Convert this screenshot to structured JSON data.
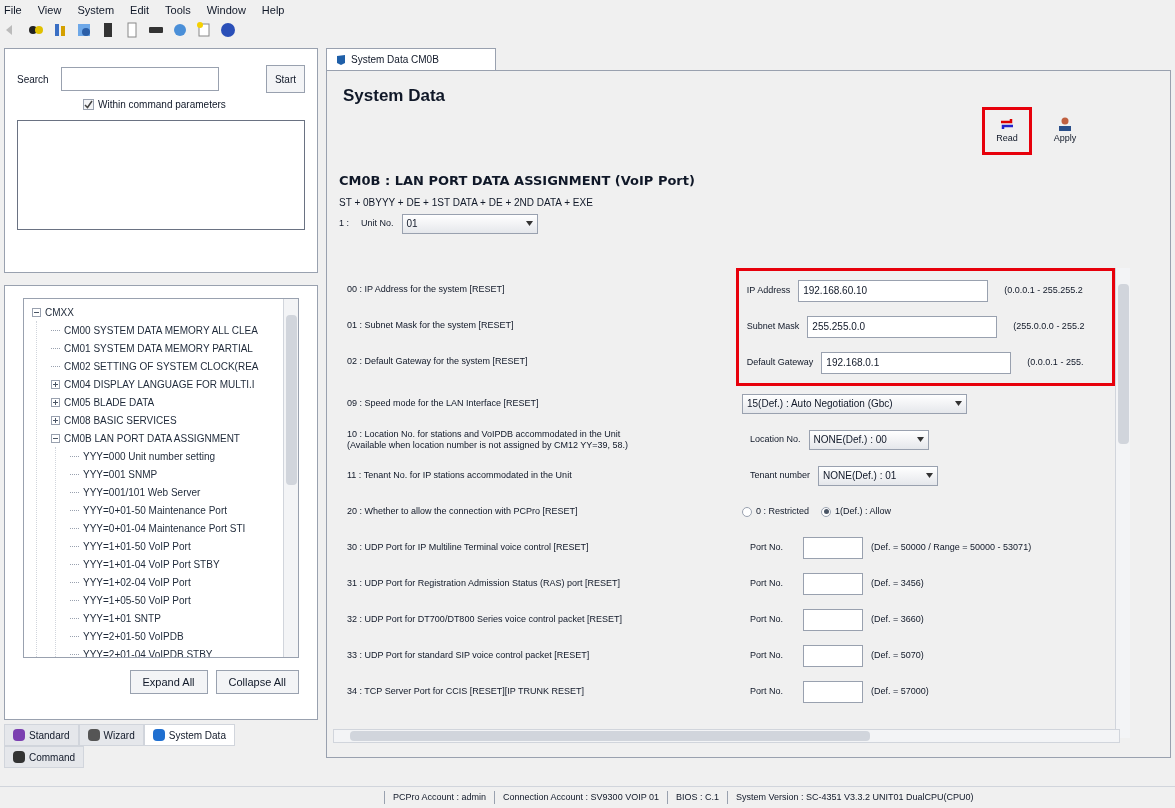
{
  "menu": [
    "File",
    "View",
    "System",
    "Edit",
    "Tools",
    "Window",
    "Help"
  ],
  "search": {
    "label": "Search",
    "button": "Start",
    "option": {
      "label": "Within command parameters",
      "checked": true
    }
  },
  "tree": [
    {
      "label": "CMXX",
      "expanded": true,
      "children": [
        {
          "label": "CM00 SYSTEM DATA MEMORY ALL CLEA"
        },
        {
          "label": "CM01 SYSTEM DATA MEMORY PARTIAL"
        },
        {
          "label": "CM02 SETTING OF SYSTEM CLOCK(REA"
        },
        {
          "label": "CM04 DISPLAY LANGUAGE FOR MULTI.I",
          "expanded": false
        },
        {
          "label": "CM05 BLADE DATA",
          "expanded": false
        },
        {
          "label": "CM08 BASIC SERVICES",
          "expanded": false
        },
        {
          "label": "CM0B LAN PORT DATA ASSIGNMENT",
          "expanded": true,
          "children": [
            {
              "label": "YYY=000 Unit number setting"
            },
            {
              "label": "YYY=001 SNMP"
            },
            {
              "label": "YYY=001/101 Web Server"
            },
            {
              "label": "YYY=0+01-50 Maintenance Port"
            },
            {
              "label": "YYY=0+01-04 Maintenance Port STI"
            },
            {
              "label": "YYY=1+01-50 VoIP Port"
            },
            {
              "label": "YYY=1+01-04 VoIP Port STBY"
            },
            {
              "label": "YYY=1+02-04 VoIP Port"
            },
            {
              "label": "YYY=1+05-50 VoIP Port"
            },
            {
              "label": "YYY=1+01 SNTP"
            },
            {
              "label": "YYY=2+01-50 VoIPDB"
            },
            {
              "label": "YYY=2+01-04 VoIPDB STBY"
            }
          ]
        }
      ]
    }
  ],
  "tree_buttons": [
    "Expand All",
    "Collapse All"
  ],
  "mode_tabs": [
    {
      "label": "Standard",
      "selected": false
    },
    {
      "label": "Wizard",
      "selected": false
    },
    {
      "label": "System Data",
      "selected": true
    },
    {
      "label": "Command",
      "selected": false
    }
  ],
  "document_tab": {
    "label": "System Data CM0B",
    "selected": true
  },
  "page": {
    "title": "System Data",
    "actions": [
      {
        "label": "Read",
        "highlighted": true
      },
      {
        "label": "Apply",
        "highlighted": false
      }
    ],
    "command_title": "CM0B : LAN PORT DATA ASSIGNMENT (VoIP Port)",
    "command_format": "ST + 0BYYY + DE + 1ST DATA + DE + 2ND DATA + EXE",
    "unit": {
      "index": "1 :",
      "label": "Unit No.",
      "value": "01"
    },
    "network_group": {
      "highlighted": true,
      "rows": [
        {
          "description": "00 : IP Address for the system [RESET]",
          "label": "IP Address",
          "value": "192.168.60.10",
          "range": "(0.0.0.1 - 255.255.2"
        },
        {
          "description": "01 : Subnet Mask for the system [RESET]",
          "label": "Subnet Mask",
          "value": "255.255.0.0",
          "range": "(255.0.0.0 - 255.2"
        },
        {
          "description": "02 : Default Gateway for the system [RESET]",
          "label": "Default Gateway",
          "value": "192.168.0.1",
          "range": "(0.0.0.1 - 255."
        }
      ]
    },
    "rows": [
      {
        "description": "09 : Speed mode for the LAN Interface [RESET]",
        "kind": "select",
        "value": "15(Def.) : Auto Negotiation (Gbc)"
      },
      {
        "description": "10 : Location No. for stations and VoIPDB accommodated in the Unit\n(Available when location number is not assigned by CM12 YY=39, 58.)",
        "kind": "select",
        "label": "Location No.",
        "value": "NONE(Def.) : 00"
      },
      {
        "description": "11 : Tenant No. for IP stations accommodated in the Unit",
        "kind": "select",
        "label": "Tenant number",
        "value": "NONE(Def.) : 01"
      },
      {
        "description": "20 : Whether to allow the connection with PCPro [RESET]",
        "kind": "radio",
        "options": [
          {
            "label": "0 : Restricted",
            "selected": false
          },
          {
            "label": "1(Def.) : Allow",
            "selected": true
          }
        ]
      },
      {
        "description": "30 : UDP Port for IP Multiline Terminal voice control [RESET]",
        "kind": "port",
        "label": "Port No.",
        "hint": "(Def. = 50000 / Range = 50000 - 53071)"
      },
      {
        "description": "31 : UDP Port for Registration Admission Status (RAS) port [RESET]",
        "kind": "port",
        "label": "Port No.",
        "hint": "(Def. = 3456)"
      },
      {
        "description": "32 : UDP Port for DT700/DT800 Series voice control packet [RESET]",
        "kind": "port",
        "label": "Port No.",
        "hint": "(Def. = 3660)"
      },
      {
        "description": "33 : UDP Port for standard SIP voice control packet [RESET]",
        "kind": "port",
        "label": "Port No.",
        "hint": "(Def. = 5070)"
      },
      {
        "description": "34 : TCP Server Port for CCIS [RESET][IP TRUNK RESET]",
        "kind": "port",
        "label": "Port No.",
        "hint": "(Def. = 57000)"
      }
    ]
  },
  "status_bar": [
    "PCPro Account : admin",
    "Connection Account : SV9300 VOIP 01",
    "BIOS : C.1",
    "System Version : SC-4351 V3.3.2 UNIT01 DualCPU(CPU0)"
  ]
}
